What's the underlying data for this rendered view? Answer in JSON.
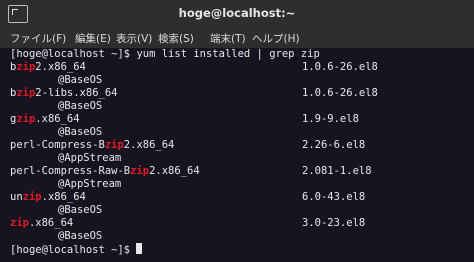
{
  "window": {
    "title": "hoge@localhost:~",
    "new_tab_icon": "new-tab-icon"
  },
  "menu": {
    "items": [
      "ファイル(F)",
      "編集(E)",
      "表示(V)",
      "検索(S)",
      "端末(T)",
      "ヘルプ(H)"
    ]
  },
  "terminal": {
    "prompt1": "[hoge@localhost ~]$ ",
    "command": "yum list installed | grep zip",
    "packages": [
      {
        "pre": "b",
        "hl": "zip",
        "post": "2.x86_64",
        "version": "1.0.6-26.el8",
        "repo": "@BaseOS"
      },
      {
        "pre": "b",
        "hl": "zip",
        "post": "2-libs.x86_64",
        "version": "1.0.6-26.el8",
        "repo": "@BaseOS"
      },
      {
        "pre": "g",
        "hl": "zip",
        "post": ".x86_64",
        "version": "1.9-9.el8",
        "repo": "@BaseOS"
      },
      {
        "pre": "perl-Compress-B",
        "hl": "zip",
        "post": "2.x86_64",
        "version": "2.26-6.el8",
        "repo": "@AppStream"
      },
      {
        "pre": "perl-Compress-Raw-B",
        "hl": "zip",
        "post": "2.x86_64",
        "version": "2.081-1.el8",
        "repo": "@AppStream"
      },
      {
        "pre": "un",
        "hl": "zip",
        "post": ".x86_64",
        "version": "6.0-43.el8",
        "repo": "@BaseOS"
      },
      {
        "pre": "",
        "hl": "zip",
        "post": ".x86_64",
        "version": "3.0-23.el8",
        "repo": "@BaseOS"
      }
    ],
    "prompt2": "[hoge@localhost ~]$ "
  },
  "colors": {
    "highlight": "#e01b24",
    "text": "#e8e8e8",
    "background": "#171421",
    "chrome": "#2e2e2e"
  }
}
